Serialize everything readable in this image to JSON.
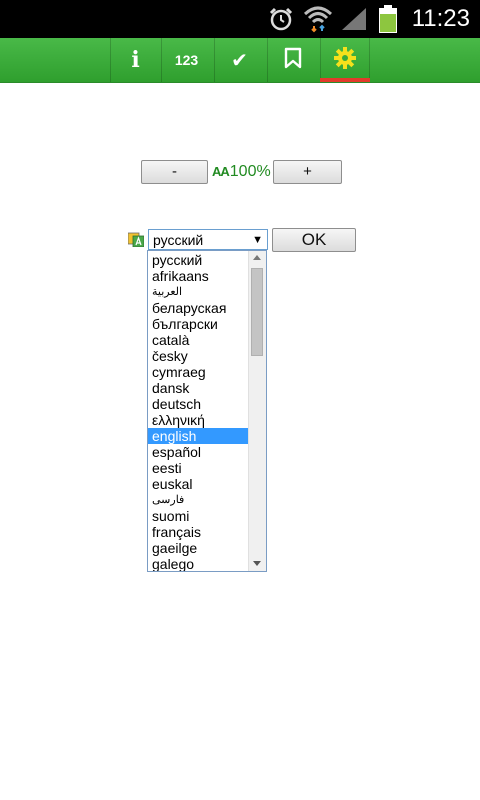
{
  "status_bar": {
    "time": "11:23",
    "icons": [
      "alarm-icon",
      "wifi-icon",
      "signal-icon",
      "battery-icon"
    ]
  },
  "toolbar": {
    "buttons": [
      {
        "name": "info",
        "label": "i"
      },
      {
        "name": "numbers",
        "label": "123"
      },
      {
        "name": "check",
        "label": "✔"
      },
      {
        "name": "bookmark",
        "label": ""
      },
      {
        "name": "settings",
        "label": ""
      }
    ],
    "active": "settings",
    "accent_color": "#e23b2b",
    "bar_color": "#3aab39"
  },
  "zoom": {
    "minus_label": "-",
    "plus_label": "+",
    "aa_label": "AA",
    "value": "100%"
  },
  "language": {
    "selected": "русский",
    "ok_label": "OK",
    "highlighted": "english",
    "options": [
      "русский",
      "afrikaans",
      "العربية",
      "беларуская",
      "български",
      "català",
      "česky",
      "cymraeg",
      "dansk",
      "deutsch",
      "ελληνική",
      "english",
      "español",
      "eesti",
      "euskal",
      "فارسی",
      "suomi",
      "français",
      "gaeilge",
      "galego"
    ]
  }
}
